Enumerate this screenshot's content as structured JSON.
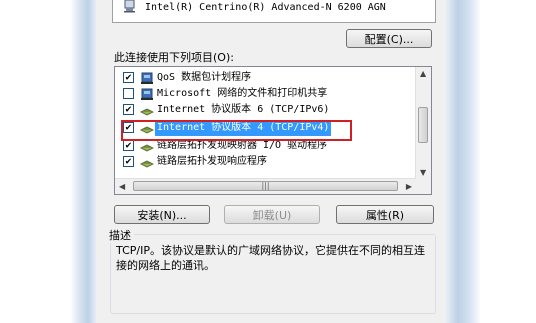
{
  "adapter": {
    "name": "Intel(R) Centrino(R) Advanced-N 6200 AGN",
    "icon": "network-adapter-icon"
  },
  "configure_label": "配置(C)...",
  "uses_label": "此连接使用下列项目(O):",
  "items": [
    {
      "label": "QoS 数据包计划程序",
      "checked": true,
      "icon": "qos-icon"
    },
    {
      "label": "Microsoft 网络的文件和打印机共享",
      "checked": false,
      "icon": "file-printer-share-icon"
    },
    {
      "label": "Internet 协议版本 6 (TCP/IPv6)",
      "checked": true,
      "icon": "protocol-icon"
    },
    {
      "label": "Internet 协议版本 4 (TCP/IPv4)",
      "checked": true,
      "icon": "protocol-icon",
      "selected": true
    },
    {
      "label": "链路层拓扑发现映射器 I/O 驱动程序",
      "checked": true,
      "icon": "protocol-icon"
    },
    {
      "label": "链路层拓扑发现响应程序",
      "checked": true,
      "icon": "protocol-icon"
    }
  ],
  "buttons": {
    "install": "安装(N)...",
    "uninstall": "卸载(U)",
    "properties": "属性(R)"
  },
  "description": {
    "title": "描述",
    "text": "TCP/IP。该协议是默认的广域网络协议，它提供在不同的相互连接的网络上的通讯。"
  },
  "colors": {
    "selection": "#3399ff",
    "highlight_border": "#d21f26"
  }
}
